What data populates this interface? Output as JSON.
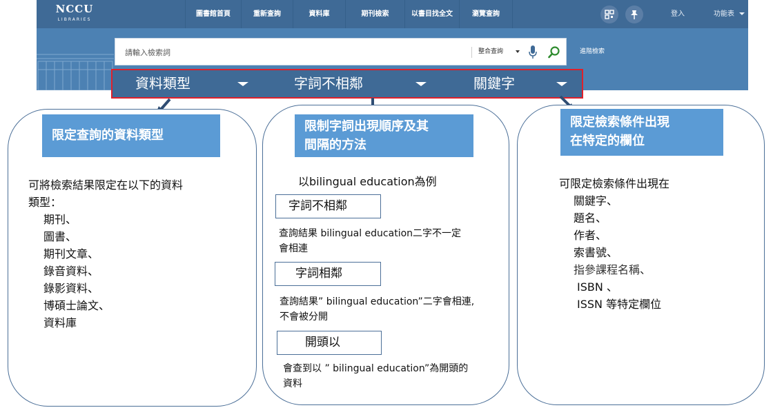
{
  "nav": {
    "logo_main": "NCCU",
    "logo_sub": "LIBRARIES",
    "items": [
      "圖書館首頁",
      "重新查詢",
      "資料庫",
      "期刊檢索",
      "以書目找全文",
      "瀏覽查詢"
    ],
    "login": "登入",
    "menu": "功能表"
  },
  "search": {
    "placeholder": "請輸入檢索詞",
    "scope": "整合查詢",
    "advanced": "進階檢索"
  },
  "filters": [
    "資料類型",
    "字詞不相鄰",
    "關鍵字"
  ],
  "panel_left": {
    "heading": "限定查詢的資料類型",
    "intro_1": "可將檢索結果限定在以下的資料",
    "intro_2": "類型：",
    "types": [
      "期刊、",
      "圖書、",
      "期刊文章、",
      "錄音資料、",
      "錄影資料、",
      "博碩士論文、",
      "資料庫"
    ]
  },
  "panel_middle": {
    "heading_1": "限制字詞出現順序及其",
    "heading_2": "間隔的方法",
    "example": "以bilingual education為例",
    "options": [
      {
        "label": "字詞不相鄰",
        "desc_1": "查詢結果 bilingual education二字不一定",
        "desc_2": "會相連"
      },
      {
        "label": "字詞相鄰",
        "desc_1": "查詢結果” bilingual education”二字會相連,",
        "desc_2": "不會被分開"
      },
      {
        "label": "開頭以",
        "desc_1": "會查到以 ” bilingual education”為開頭的",
        "desc_2": "資料"
      }
    ]
  },
  "panel_right": {
    "heading_1": "限定檢索條件出現",
    "heading_2": "在特定的欄位",
    "intro": "可限定檢索條件出現在",
    "fields": [
      "關鍵字、",
      "題名、",
      "作者、",
      "索書號、",
      "指參課程名稱、",
      "ISBN 、",
      "ISSN 等特定欄位"
    ]
  },
  "colors": {
    "banner": "#4c81b3",
    "navbar": "#3f6a96",
    "highlight_border": "#e0202a",
    "heading_bg": "#5b9bd5",
    "panel_border": "#4a6e97"
  }
}
